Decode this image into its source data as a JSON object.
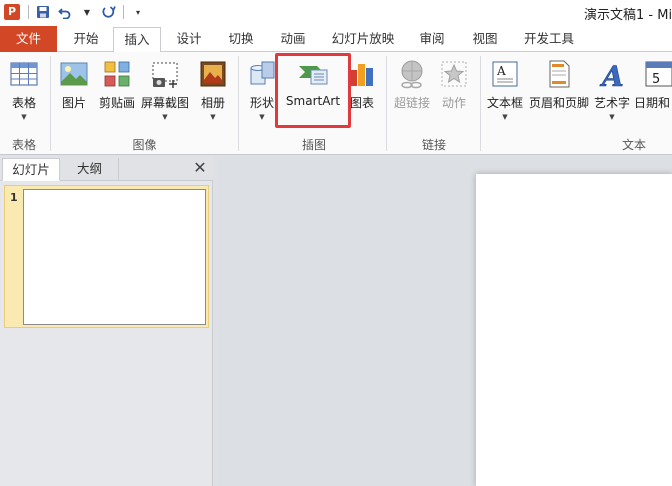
{
  "window": {
    "title": "演示文稿1 - Mi",
    "app_icon_letter": "P"
  },
  "ribbon_tabs": [
    {
      "label": "文件"
    },
    {
      "label": "开始"
    },
    {
      "label": "插入"
    },
    {
      "label": "设计"
    },
    {
      "label": "切换"
    },
    {
      "label": "动画"
    },
    {
      "label": "幻灯片放映"
    },
    {
      "label": "审阅"
    },
    {
      "label": "视图"
    },
    {
      "label": "开发工具"
    }
  ],
  "ribbon": {
    "buttons": {
      "table": "表格",
      "picture": "图片",
      "clipart": "剪贴画",
      "screenshot": "屏幕截图",
      "album": "相册",
      "shapes": "形状",
      "smartart": "SmartArt",
      "chart": "图表",
      "hyperlink": "超链接",
      "action": "动作",
      "textbox": "文本框",
      "header_footer": "页眉和页脚",
      "wordart": "艺术字",
      "datetime": "日期和"
    },
    "groups": {
      "tables": "表格",
      "images": "图像",
      "illustrations": "插图",
      "links": "链接",
      "text": "文本"
    }
  },
  "slide_pane": {
    "tabs": [
      "幻灯片",
      "大纲"
    ],
    "close_glyph": "✕",
    "slides": [
      {
        "number": "1"
      }
    ]
  },
  "colors": {
    "file_tab": "#d24726",
    "highlight": "#e03a3e",
    "selected_slide": "#fbe9b2"
  }
}
